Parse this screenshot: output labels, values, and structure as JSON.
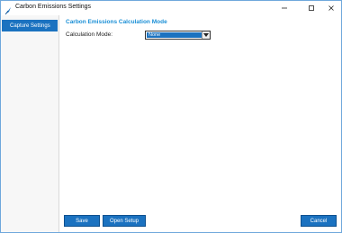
{
  "window": {
    "title": "Carbon Emissions Settings"
  },
  "sidebar": {
    "items": [
      {
        "label": "Capture Settings"
      }
    ]
  },
  "main": {
    "section_title": "Carbon Emissions Calculation Mode",
    "calculation_mode_label": "Calculation Mode:",
    "calculation_mode_value": "None"
  },
  "buttons": {
    "save": "Save",
    "open_setup": "Open Setup",
    "cancel": "Cancel"
  },
  "colors": {
    "accent": "#1b72c0",
    "section_title": "#1a8fd6",
    "sidebar_bg": "#f7f7f7"
  },
  "icons": {
    "app": "feather-icon",
    "minimize": "minimize-icon",
    "maximize": "maximize-icon",
    "close": "close-icon",
    "dropdown": "chevron-down-icon"
  }
}
